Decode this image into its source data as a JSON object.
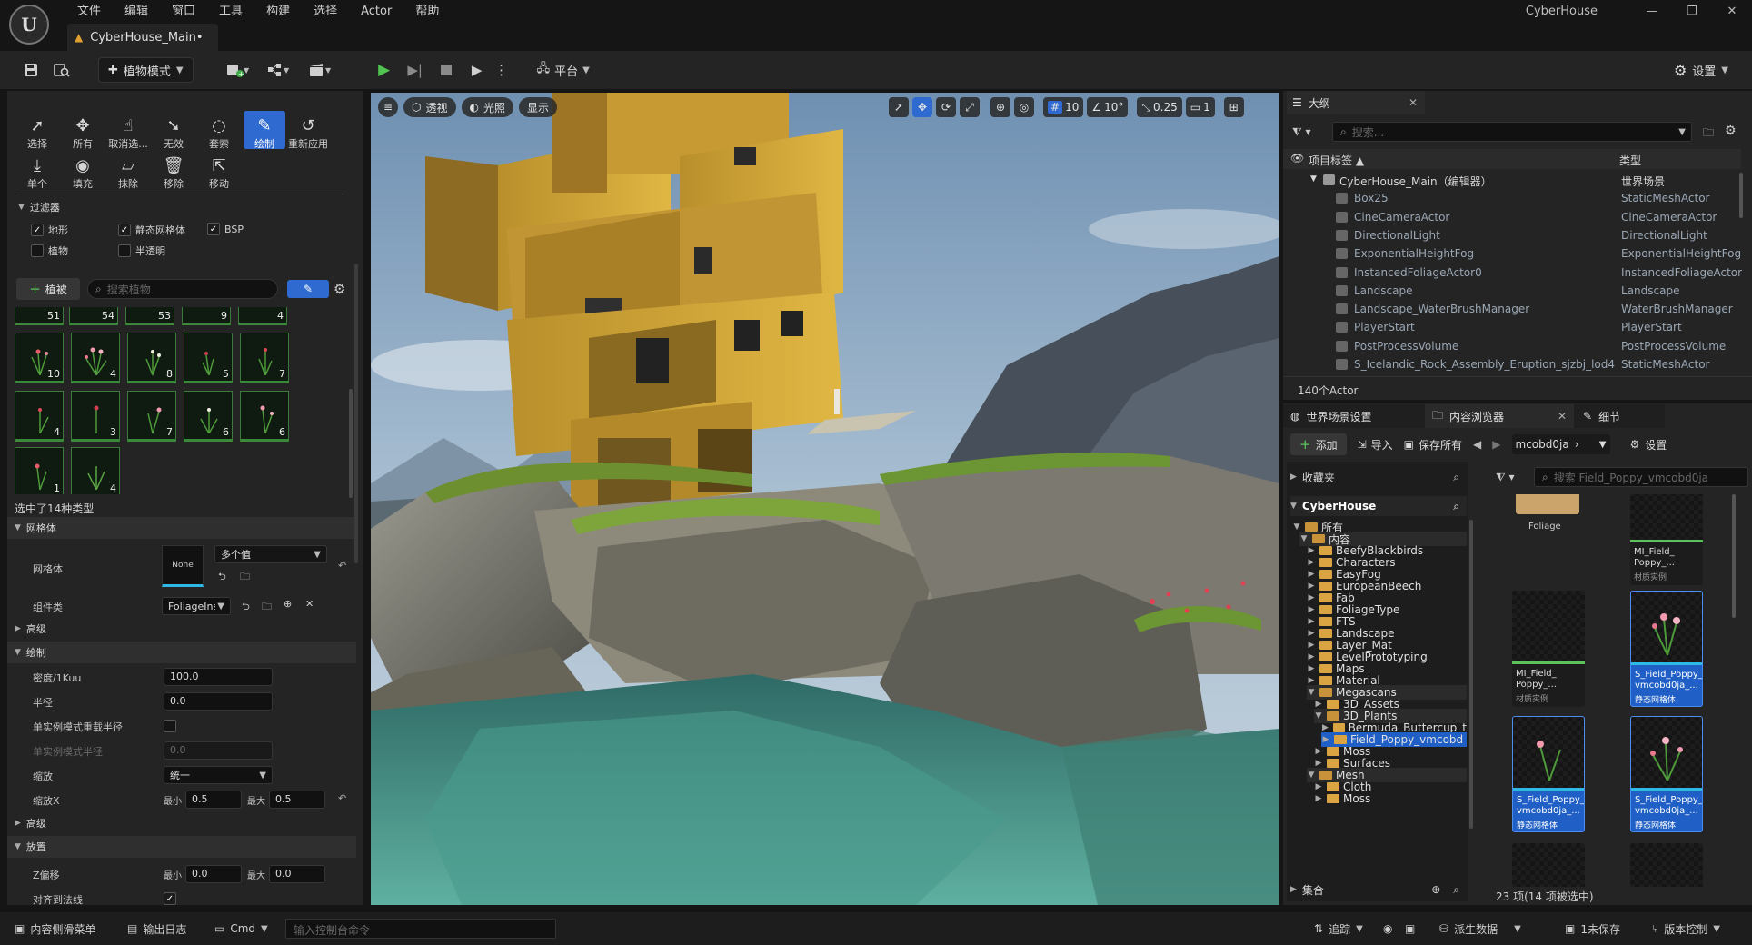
{
  "app": {
    "name": "CyberHouse",
    "doc_tab": "CyberHouse_Main•",
    "menu": [
      "文件",
      "编辑",
      "窗口",
      "工具",
      "构建",
      "选择",
      "Actor",
      "帮助"
    ]
  },
  "toolbar": {
    "mode": "植物模式",
    "platform": "平台",
    "settings": "设置"
  },
  "foliage": {
    "tools_row1": [
      "选择",
      "所有",
      "取消选...",
      "无效",
      "套索",
      "绘制",
      "重新应用"
    ],
    "tools_row2": [
      "单个",
      "填充",
      "抹除",
      "移除",
      "移动"
    ],
    "filters_title": "过滤器",
    "filters": [
      {
        "label": "地形",
        "checked": true
      },
      {
        "label": "静态网格体",
        "checked": true
      },
      {
        "label": "BSP",
        "checked": true
      },
      {
        "label": "植物",
        "checked": false
      },
      {
        "label": "半透明",
        "checked": false
      }
    ],
    "add_button": "植被",
    "search_placeholder": "搜索植物",
    "thumb_counts_partial": [
      "51",
      "54",
      "53",
      "9",
      "4"
    ],
    "thumb_counts": [
      "10",
      "4",
      "8",
      "5",
      "7",
      "4",
      "3",
      "7",
      "6",
      "6",
      "1",
      "4"
    ],
    "selected_summary": "选中了14种类型",
    "sections": {
      "mesh": "网格体",
      "advanced": "高级",
      "paint": "绘制",
      "advanced2": "高级",
      "placement": "放置"
    },
    "props": {
      "mesh_label": "网格体",
      "mesh_value": "多个值",
      "mesh_thumb": "None",
      "component_label": "组件类",
      "component_value": "FoliageIns",
      "density_label": "密度/1Kuu",
      "density_value": "100.0",
      "radius_label": "半径",
      "radius_value": "0.0",
      "single_override_label": "单实例模式重载半径",
      "single_radius_label": "单实例模式半径",
      "single_radius_value": "0.0",
      "scale_label": "缩放",
      "scale_value": "统一",
      "scalex_label": "缩放X",
      "min_label": "最小",
      "max_label": "最大",
      "scalex_min": "0.5",
      "scalex_max": "0.5",
      "zoffset_label": "Z偏移",
      "zoffset_min": "0.0",
      "zoffset_max": "0.0",
      "align_normal_label": "对齐到法线"
    }
  },
  "viewport": {
    "perspective": "透视",
    "lighting": "光照",
    "show": "显示",
    "grid_snap": "10",
    "rot_snap": "10°",
    "scale_snap": "0.25",
    "camera_speed": "1"
  },
  "outliner": {
    "tab": "大纲",
    "search_placeholder": "搜索...",
    "col_label": "项目标签 ▲",
    "col_type": "类型",
    "rows": [
      {
        "name": "CyberHouse_Main（编辑器）",
        "type": "世界场景",
        "root": true
      },
      {
        "name": "Box25",
        "type": "StaticMeshActor"
      },
      {
        "name": "CineCameraActor",
        "type": "CineCameraActor"
      },
      {
        "name": "DirectionalLight",
        "type": "DirectionalLight"
      },
      {
        "name": "ExponentialHeightFog",
        "type": "ExponentialHeightFog"
      },
      {
        "name": "InstancedFoliageActor0",
        "type": "InstancedFoliageActor"
      },
      {
        "name": "Landscape",
        "type": "Landscape"
      },
      {
        "name": "Landscape_WaterBrushManager",
        "type": "WaterBrushManager"
      },
      {
        "name": "PlayerStart",
        "type": "PlayerStart"
      },
      {
        "name": "PostProcessVolume",
        "type": "PostProcessVolume"
      },
      {
        "name": "S_Icelandic_Rock_Assembly_Eruption_sjzbj_lod4",
        "type": "StaticMeshActor"
      }
    ],
    "count": "140个Actor"
  },
  "content_browser": {
    "tabs": [
      "世界场景设置",
      "内容浏览器",
      "细节"
    ],
    "add": "添加",
    "import": "导入",
    "save_all": "保存所有",
    "path": "mcobd0ja",
    "settings": "设置",
    "favorites": "收藏夹",
    "project": "CyberHouse",
    "collections": "集合",
    "search_placeholder": "搜索 Field_Poppy_vmcobd0ja",
    "tree": [
      {
        "label": "所有",
        "depth": 0,
        "open": true
      },
      {
        "label": "内容",
        "depth": 1,
        "open": true
      },
      {
        "label": "BeefyBlackbirds",
        "depth": 2
      },
      {
        "label": "Characters",
        "depth": 2
      },
      {
        "label": "EasyFog",
        "depth": 2
      },
      {
        "label": "EuropeanBeech",
        "depth": 2
      },
      {
        "label": "Fab",
        "depth": 2
      },
      {
        "label": "FoliageType",
        "depth": 2
      },
      {
        "label": "FTS",
        "depth": 2
      },
      {
        "label": "Landscape",
        "depth": 2
      },
      {
        "label": "Layer_Mat",
        "depth": 2
      },
      {
        "label": "LevelPrototyping",
        "depth": 2
      },
      {
        "label": "Maps",
        "depth": 2
      },
      {
        "label": "Material",
        "depth": 2
      },
      {
        "label": "Megascans",
        "depth": 2,
        "open": true
      },
      {
        "label": "3D_Assets",
        "depth": 3
      },
      {
        "label": "3D_Plants",
        "depth": 3,
        "open": true
      },
      {
        "label": "Bermuda_Buttercup_t",
        "depth": 4
      },
      {
        "label": "Field_Poppy_vmcobd",
        "depth": 4,
        "selected": true
      },
      {
        "label": "Moss",
        "depth": 3
      },
      {
        "label": "Surfaces",
        "depth": 3
      },
      {
        "label": "Mesh",
        "depth": 2,
        "open": true
      },
      {
        "label": "Cloth",
        "depth": 3
      },
      {
        "label": "Moss",
        "depth": 3
      }
    ],
    "assets": [
      {
        "name": "Foliage",
        "type": "",
        "kind": "folder"
      },
      {
        "name": "MI_Field_ Poppy_...",
        "type": "材质实例",
        "kind": "mi"
      },
      {
        "name": "MI_Field_ Poppy_...",
        "type": "材质实例",
        "kind": "mi"
      },
      {
        "name": "S_Field_Poppy_ vmcobd0ja_...",
        "type": "静态网格体",
        "kind": "mesh",
        "selected": true
      },
      {
        "name": "S_Field_Poppy_ vmcobd0ja_...",
        "type": "静态网格体",
        "kind": "mesh",
        "selected": true
      },
      {
        "name": "S_Field_Poppy_ vmcobd0ja_...",
        "type": "静态网格体",
        "kind": "mesh",
        "selected": true
      }
    ],
    "status": "23 项(14 项被选中)"
  },
  "statusbar": {
    "drawer": "内容侧滑菜单",
    "output_log": "输出日志",
    "cmd": "Cmd",
    "console_placeholder": "输入控制台命令",
    "trace": "追踪",
    "derived": "派生数据",
    "unsaved": "1未保存",
    "source_control": "版本控制"
  },
  "colors": {
    "accent": "#2e6ad0",
    "panel": "#242424",
    "foliage_green": "#3b8a3b",
    "mesh_bar": "#2db8e6",
    "mi_bar": "#5cc25c"
  }
}
